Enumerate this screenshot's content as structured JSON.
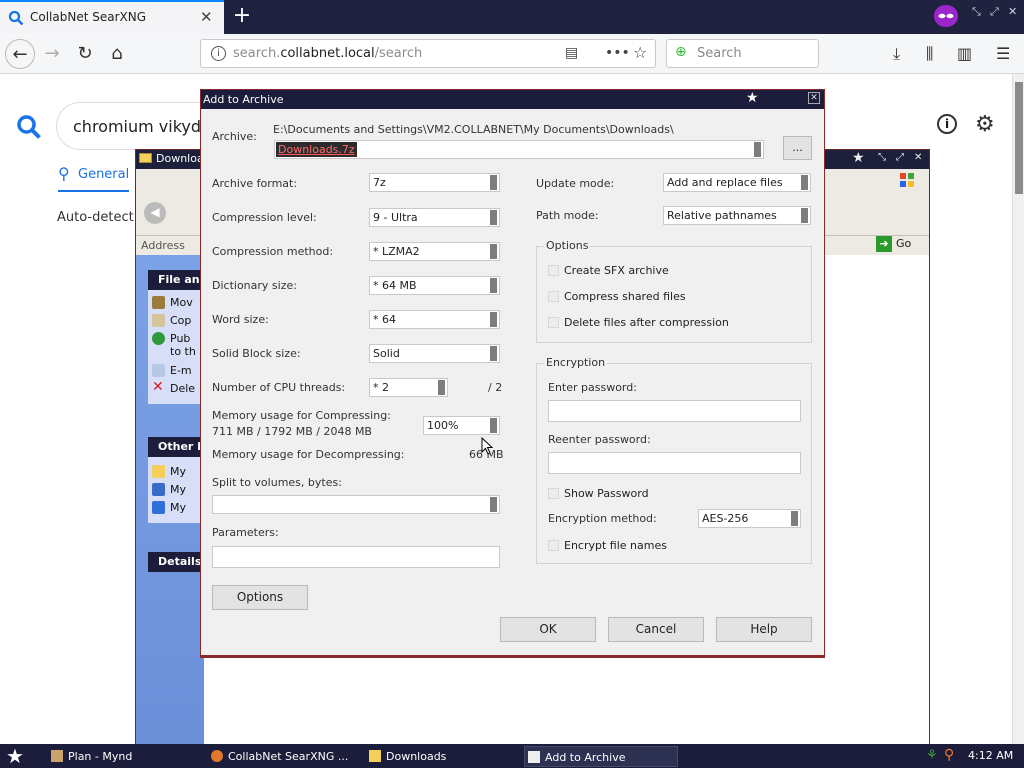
{
  "browser": {
    "tab_title": "CollabNet SearXNG",
    "url_prefix": "search.",
    "url_host": "collabnet.local",
    "url_path": "/search",
    "search_placeholder": "Search",
    "new_tab": "+",
    "tab_close": "✕"
  },
  "page": {
    "query": "chromium vikyd",
    "category_general": "General",
    "autodetect": "Auto-detect (e"
  },
  "explorer": {
    "title": "Download",
    "address_label": "Address",
    "go_label": "Go",
    "panels": [
      {
        "header": "File and",
        "items": [
          "Mov",
          "Cop",
          "Pub to th",
          "E-m",
          "Dele"
        ]
      },
      {
        "header": "Other P",
        "items": [
          "My",
          "My",
          "My"
        ]
      },
      {
        "header": "Details"
      }
    ]
  },
  "dialog": {
    "title": "Add to Archive",
    "archive_label": "Archive:",
    "archive_path": "E:\\Documents and Settings\\VM2.COLLABNET\\My Documents\\Downloads\\",
    "archive_name": "Downloads.7z",
    "browse_label": "...",
    "format_label": "Archive format:",
    "format_value": "7z",
    "level_label": "Compression level:",
    "level_value": "9 - Ultra",
    "method_label": "Compression method:",
    "method_value": "* LZMA2",
    "dict_label": "Dictionary size:",
    "dict_value": "* 64 MB",
    "word_label": "Word size:",
    "word_value": "* 64",
    "solid_label": "Solid Block size:",
    "solid_value": "Solid",
    "threads_label": "Number of CPU threads:",
    "threads_value": "* 2",
    "threads_max": "/ 2",
    "mem_comp_label": "Memory usage for Compressing:",
    "mem_comp_value": "711 MB / 1792 MB / 2048 MB",
    "mem_percent": "100%",
    "mem_decomp_label": "Memory usage for Decompressing:",
    "mem_decomp_value": "66 MB",
    "split_label": "Split to volumes, bytes:",
    "params_label": "Parameters:",
    "options_button": "Options",
    "update_mode_label": "Update mode:",
    "update_mode_value": "Add and replace files",
    "path_mode_label": "Path mode:",
    "path_mode_value": "Relative pathnames",
    "options_group": "Options",
    "opt_sfx": "Create SFX archive",
    "opt_shared": "Compress shared files",
    "opt_delete": "Delete files after compression",
    "encryption_group": "Encryption",
    "enter_password_label": "Enter password:",
    "reenter_password_label": "Reenter password:",
    "show_password": "Show Password",
    "enc_method_label": "Encryption method:",
    "enc_method_value": "AES-256",
    "encrypt_names": "Encrypt file names",
    "ok": "OK",
    "cancel": "Cancel",
    "help": "Help"
  },
  "taskbar": {
    "items": [
      "Plan - Mynd",
      "CollabNet SearXNG ...",
      "Downloads",
      "Add to Archive"
    ],
    "clock": "4:12 AM"
  },
  "colors": {
    "firefox_accent": "#0a84ff",
    "title_bar": "#1b1d3a",
    "search_blue": "#1a73e8",
    "window_border": "#8a2a2a"
  }
}
